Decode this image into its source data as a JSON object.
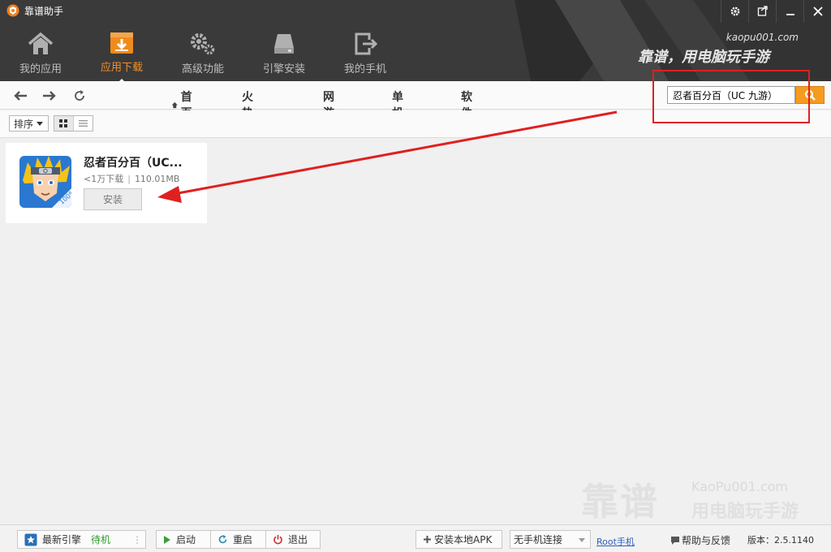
{
  "app": {
    "title": "靠谱助手"
  },
  "window": {
    "settings_icon": "gear-icon",
    "restore_icon": "restore-icon",
    "minimize_icon": "minimize-icon",
    "close_icon": "close-icon"
  },
  "nav": {
    "items": [
      {
        "label": "我的应用",
        "icon": "home-icon"
      },
      {
        "label": "应用下载",
        "icon": "download-box-icon",
        "active": true
      },
      {
        "label": "高级功能",
        "icon": "gears-icon"
      },
      {
        "label": "引擎安装",
        "icon": "drive-icon"
      },
      {
        "label": "我的手机",
        "icon": "phone-export-icon"
      }
    ]
  },
  "brand": {
    "url": "kaopu001.com",
    "slogan": "靠谱，用电脑玩手游"
  },
  "toolbar": {
    "tabs": [
      "首页",
      "火热推荐",
      "网游",
      "单机",
      "软件"
    ],
    "search_value": "忍者百分百（UC 九游）"
  },
  "sortbar": {
    "sort_label": "排序"
  },
  "results": [
    {
      "name": "忍者百分百（UC...",
      "downloads": "<1万下载",
      "size": "110.01MB",
      "install_label": "安装",
      "icon_badge": "100%"
    }
  ],
  "statusbar": {
    "engine_label": "最新引擎",
    "engine_status": "待机",
    "start_label": "启动",
    "restart_label": "重启",
    "exit_label": "退出",
    "install_apk_label": "安装本地APK",
    "phone_select": "无手机连接",
    "root_label": "Root手机",
    "help_label": "帮助与反馈",
    "version_label": "版本：2.5.1140"
  },
  "watermark": {
    "big": "靠谱",
    "url": "KaoPu001.com",
    "slogan": "用电脑玩手游"
  },
  "colors": {
    "accent": "#f39c1f",
    "header_bg": "#3a3a3a",
    "nav_active": "#f0902a",
    "annotation": "#e02020",
    "status_green": "#2e9a2e"
  }
}
